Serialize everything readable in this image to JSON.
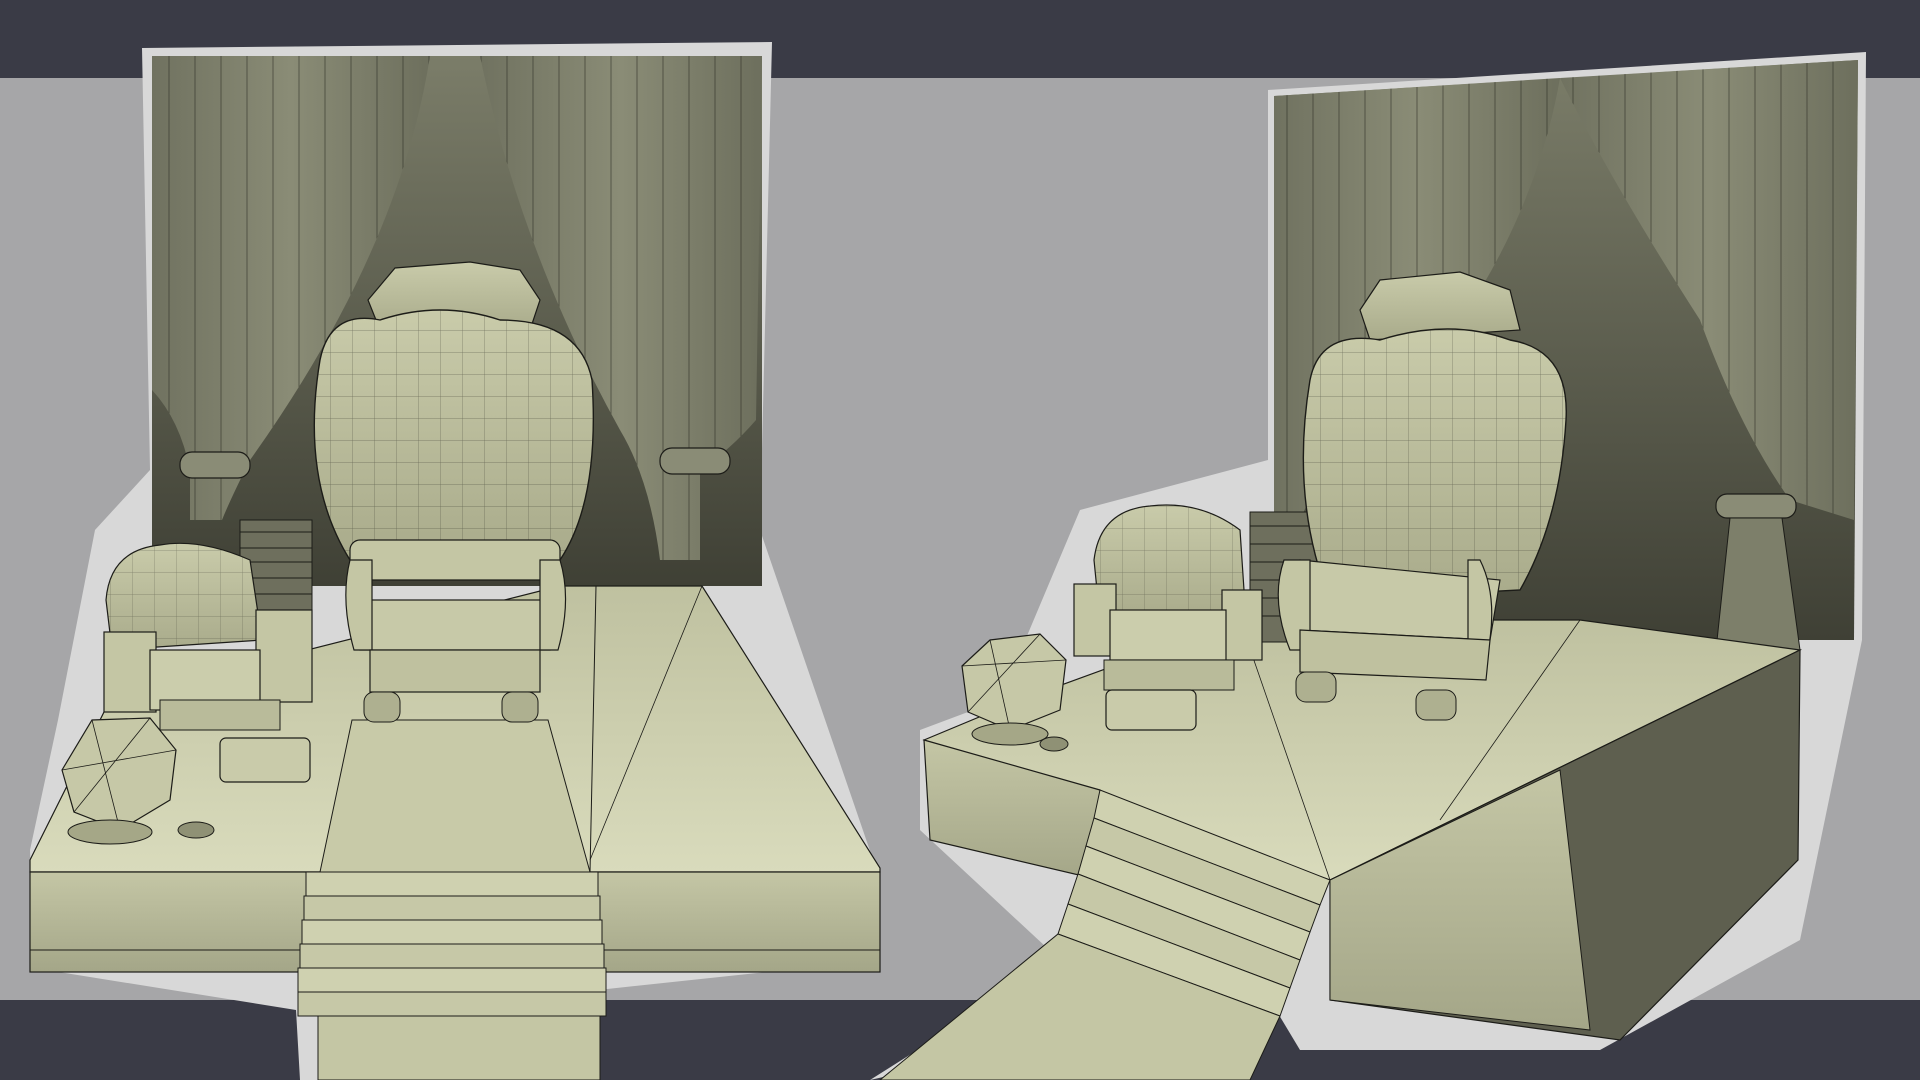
{
  "image": {
    "subject": "",
    "panels": [
      {
        "id": "front-view"
      },
      {
        "id": "three-quarter-view"
      }
    ]
  },
  "colors": {
    "band_dark": "#3a3b46",
    "band_light": "#a6a6a8",
    "model_light": "#d4d6b4",
    "model_mid": "#b6b897",
    "model_dark": "#6f705c",
    "wire": "#1c1c18",
    "outline": "#dcdcdc"
  }
}
